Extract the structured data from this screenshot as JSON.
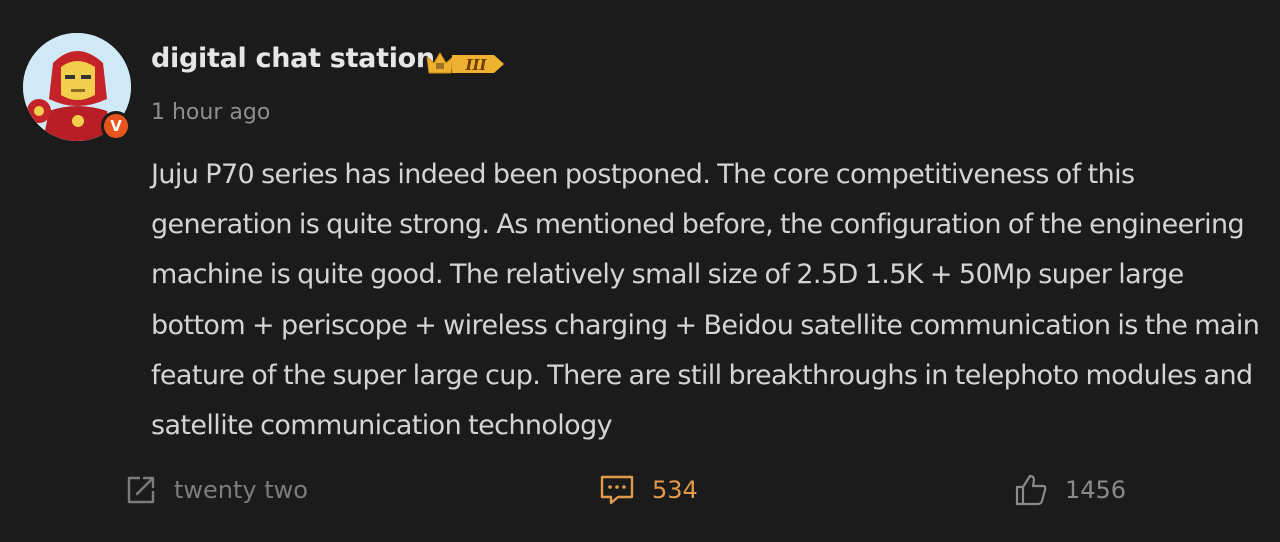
{
  "post": {
    "author": {
      "name": "digital chat station",
      "verified_badge": "V",
      "level_badge": "III",
      "level_badge_color": "#f0b030",
      "avatar_icon": "iron-man-avatar"
    },
    "timestamp": "1 hour ago",
    "content": "Juju P70 series has indeed been postponed. The core competitiveness of this generation is quite strong. As mentioned before, the configuration of the engineering machine is quite good. The relatively small size of 2.5D 1.5K + 50Mp super large bottom + periscope + wireless charging + Beidou satellite communication is the main feature of the super large cup. There are still breakthroughs in telephoto modules and satellite communication technology",
    "actions": {
      "share": {
        "label": "twenty two",
        "icon": "share-icon"
      },
      "comment": {
        "count": "534",
        "icon": "comment-icon",
        "color": "#e29a4a"
      },
      "like": {
        "count": "1456",
        "icon": "thumbs-up-icon"
      }
    }
  }
}
